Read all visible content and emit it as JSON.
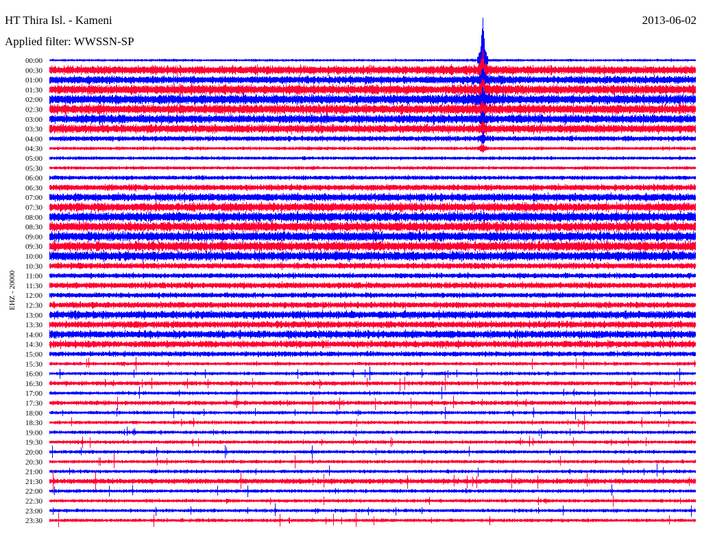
{
  "header": {
    "station": "HT Thira Isl. - Kameni",
    "filter": "Applied filter: WWSSN-SP",
    "date": "2013-06-02",
    "channel": "EHZ - 20000"
  },
  "chart_data": {
    "type": "line",
    "title": "HT Thira Isl. - Kameni",
    "subtitle": "Applied filter: WWSSN-SP",
    "ylabel": "EHZ - 20000",
    "xlabel": "",
    "colors": [
      "#0000ff",
      "#ff0033"
    ],
    "row_labels": [
      "00:00",
      "00:30",
      "01:00",
      "01:30",
      "02:00",
      "02:30",
      "03:00",
      "03:30",
      "04:00",
      "04:30",
      "05:00",
      "05:30",
      "06:00",
      "06:30",
      "07:00",
      "07:30",
      "08:00",
      "08:30",
      "09:00",
      "09:30",
      "10:00",
      "10:30",
      "11:00",
      "11:30",
      "12:00",
      "12:30",
      "13:00",
      "13:30",
      "14:00",
      "14:30",
      "15:00",
      "15:30",
      "16:00",
      "16:30",
      "17:00",
      "17:30",
      "18:00",
      "18:30",
      "19:00",
      "19:30",
      "20:00",
      "20:30",
      "21:00",
      "21:30",
      "22:00",
      "22:30",
      "23:00",
      "23:30"
    ],
    "relative_amplitude": [
      3,
      10,
      9,
      11,
      11,
      11,
      10,
      10,
      6,
      4,
      4,
      4,
      5,
      7,
      9,
      10,
      11,
      11,
      11,
      11,
      11,
      7,
      6,
      7,
      6,
      7,
      9,
      8,
      9,
      8,
      6,
      4,
      4,
      5,
      4,
      5,
      4,
      4,
      4,
      4,
      4,
      4,
      4,
      6,
      4,
      4,
      4,
      4
    ],
    "event": {
      "time_fraction_of_row": 0.67,
      "rows_affected": [
        "00:00",
        "00:30",
        "01:00",
        "01:30",
        "02:00",
        "02:30",
        "03:00",
        "03:30",
        "04:00",
        "04:30"
      ],
      "peak_relative_amplitude": 90
    },
    "grid": false
  }
}
